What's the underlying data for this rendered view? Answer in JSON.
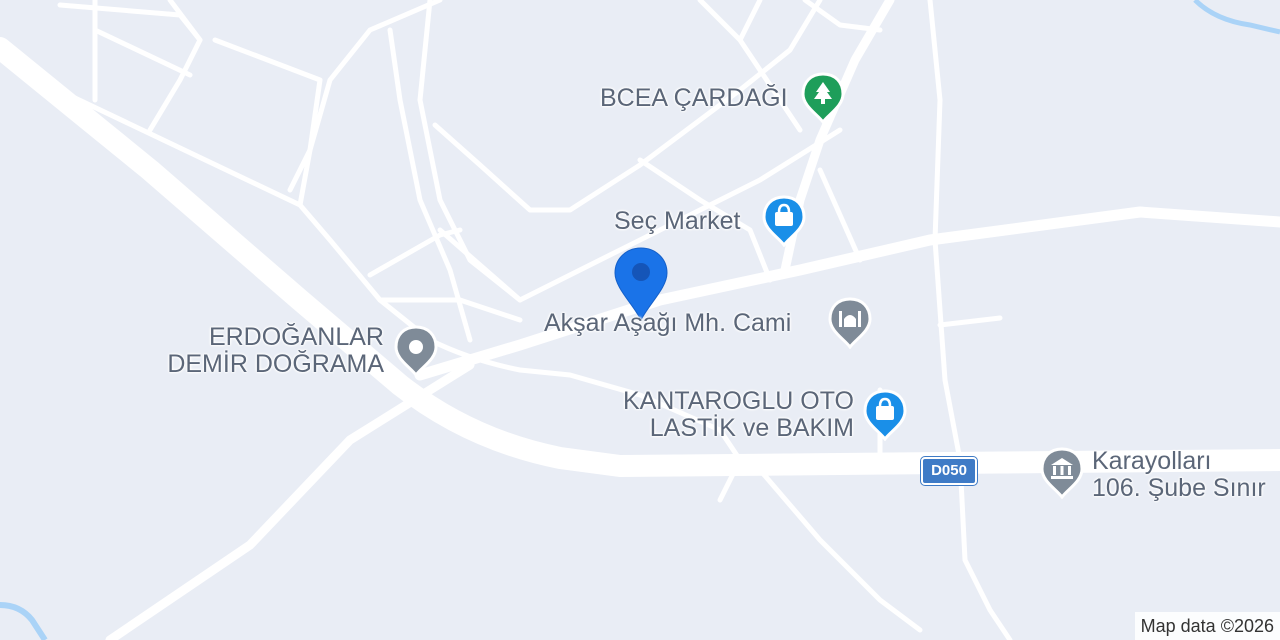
{
  "map": {
    "colors": {
      "background": "#e9edf5",
      "road": "#ffffff",
      "water": "#aad3f7",
      "poi_green": "#1e9e5a",
      "poi_shop": "#1a8fe8",
      "poi_gray": "#7f8b98",
      "location_pin": "#1a73e8",
      "route_shield": "#3f7bc6"
    },
    "route_shield": "D050",
    "attribution": "Map data ©2026",
    "location_marker": {
      "icon": "location-pin-icon"
    },
    "pois": [
      {
        "id": "bcea",
        "lines": [
          "BCEA ÇARDAĞI"
        ],
        "icon": "tree-icon",
        "kind": "park"
      },
      {
        "id": "sec-market",
        "lines": [
          "Seç Market"
        ],
        "icon": "shopping-bag-icon",
        "kind": "shop"
      },
      {
        "id": "cami",
        "lines": [
          "Akşar Aşağı Mh. Cami"
        ],
        "icon": "mosque-icon",
        "kind": "worship"
      },
      {
        "id": "erdoganlar",
        "lines": [
          "ERDOĞANLAR",
          "DEMİR DOĞRAMA"
        ],
        "icon": "generic-place-icon",
        "kind": "generic"
      },
      {
        "id": "kantaroglu",
        "lines": [
          "KANTAROGLU OTO",
          "LASTİK ve BAKIM"
        ],
        "icon": "shopping-bag-icon",
        "kind": "shop"
      },
      {
        "id": "karayollari",
        "lines": [
          "Karayolları",
          "106. Şube Sınır"
        ],
        "icon": "government-building-icon",
        "kind": "government"
      }
    ]
  }
}
